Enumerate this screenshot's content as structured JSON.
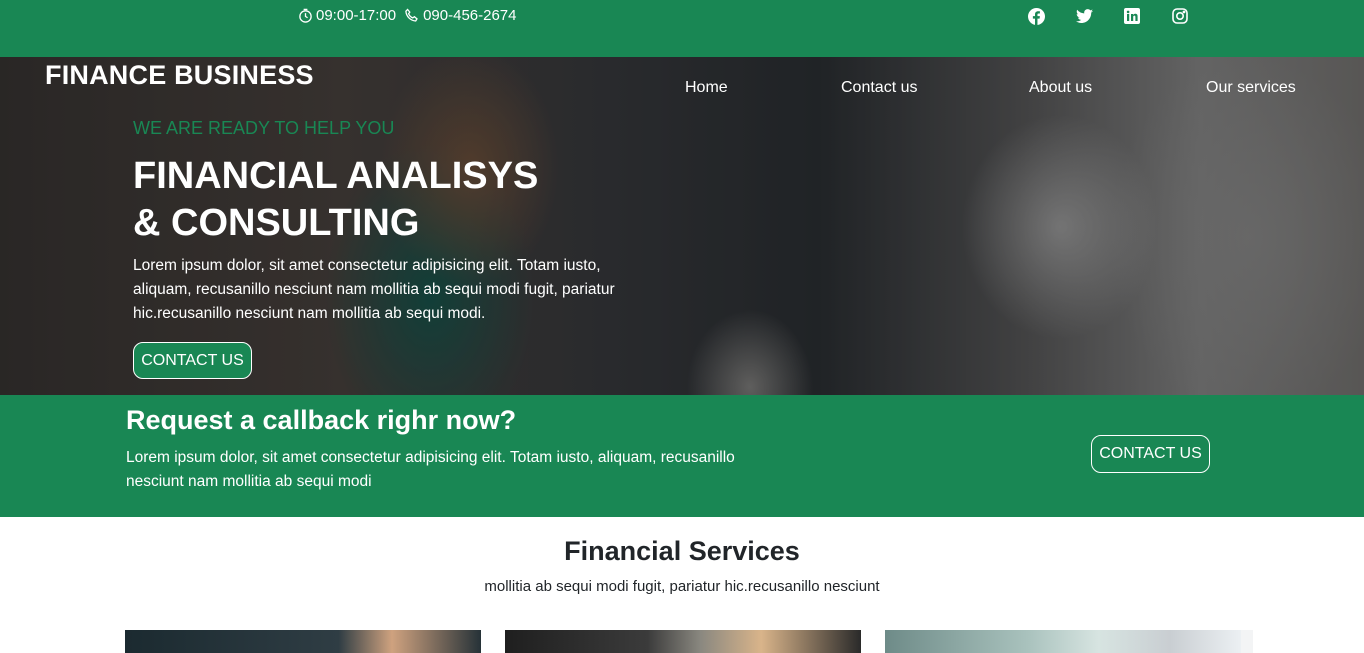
{
  "topbar": {
    "hours": "09:00-17:00",
    "phone": "090-456-2674",
    "social": [
      "facebook-icon",
      "twitter-icon",
      "linkedin-icon",
      "instagram-icon"
    ],
    "color": "#198754"
  },
  "hero": {
    "brand": "FINANCE BUSINESS",
    "nav": [
      "Home",
      "Contact us",
      "About us",
      "Our services"
    ],
    "tagline": "WE ARE READY TO HELP YOU",
    "title_line1": "FINANCIAL ANALISYS",
    "title_line2": "& CONSULTING",
    "text": "Lorem ipsum dolor, sit amet consectetur adipisicing elit. Totam iusto, aliquam, recusanillo nesciunt nam mollitia ab sequi modi fugit, pariatur hic.recusanillo nesciunt nam mollitia ab sequi modi.",
    "button": "CONTACT US"
  },
  "callback": {
    "title": "Request a callback righr now?",
    "text": "Lorem ipsum dolor, sit amet consectetur adipisicing elit. Totam iusto, aliquam, recusanillo nesciunt nam mollitia ab sequi modi",
    "button": "CONTACT US"
  },
  "services": {
    "title": "Financial Services",
    "subtitle": "mollitia ab sequi modi fugit, pariatur hic.recusanillo nesciunt"
  }
}
